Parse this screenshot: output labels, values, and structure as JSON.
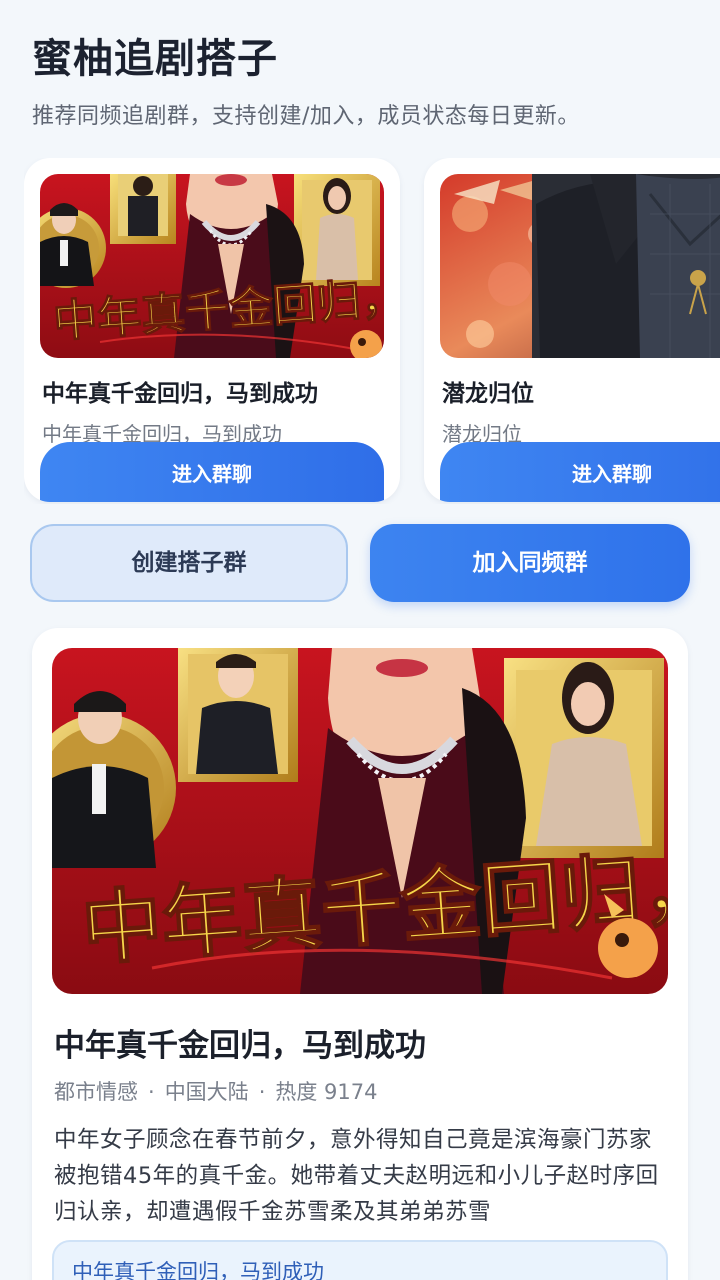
{
  "header": {
    "title": "蜜柚追剧搭子",
    "subtitle": "推荐同频追剧群，支持创建/加入，成员状态每日更新。"
  },
  "recommendations": [
    {
      "poster_text": "中年真千金回归，",
      "title": "中年真千金回归，马到成功",
      "subtitle": "中年真千金回归，马到成功",
      "join_label": "进入群聊"
    },
    {
      "poster_text": "",
      "title": "潜龙归位",
      "subtitle": "潜龙归位",
      "join_label": "进入群聊"
    }
  ],
  "actions": {
    "create_label": "创建搭子群",
    "join_label": "加入同频群"
  },
  "detail": {
    "poster_text": "中年真千金回归，",
    "title": "中年真千金回归，马到成功",
    "genre": "都市情感",
    "region": "中国大陆",
    "heat": "热度 9174",
    "separator": "·",
    "description": "中年女子顾念在春节前夕，意外得知自己竟是滨海豪门苏家被抱错45年的真千金。她带着丈夫赵明远和小儿子赵时序回归认亲，却遭遇假千金苏雪柔及其弟弟苏雪",
    "group_chip": "中年真千金回归，马到成功"
  },
  "colors": {
    "accent": "#2f72ea",
    "poster_red": "#b3121b",
    "poster_gold": "#f4d23c"
  }
}
